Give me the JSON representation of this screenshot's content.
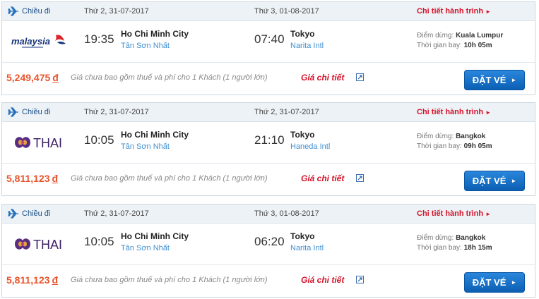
{
  "colors": {
    "header_bg": "#edf2f6",
    "link_red": "#d5132a",
    "price_orange": "#e8542c",
    "airport_blue": "#3f8fd1",
    "button_blue": "#0b5fb3"
  },
  "results": [
    {
      "direction_label": "Chiều đi",
      "dep_date": "Thứ 2, 31-07-2017",
      "arr_date": "Thứ 3, 01-08-2017",
      "details_label": "Chi tiết hành trình",
      "airline": "malaysia",
      "airline_logo_text": "malaysia",
      "dep_time": "19:35",
      "dep_city": "Ho Chi Minh City",
      "dep_airport": "Tân Sơn Nhất",
      "arr_time": "07:40",
      "arr_city": "Tokyo",
      "arr_airport": "Narita Intl",
      "stop_label": "Điểm dừng:",
      "stop_value": "Kuala Lumpur",
      "duration_label": "Thời gian bay:",
      "duration_value": "10h 05m",
      "price": "5,249,475",
      "currency": "đ",
      "price_note": "Giá chưa bao gồm thuế và phí cho 1 Khách (1 người lớn)",
      "fare_details_label": "Giá chi tiết",
      "book_label": "ĐẶT VÉ"
    },
    {
      "direction_label": "Chiều đi",
      "dep_date": "Thứ 2, 31-07-2017",
      "arr_date": "Thứ 2, 31-07-2017",
      "details_label": "Chi tiết hành trình",
      "airline": "thai",
      "airline_logo_text": "THAI",
      "dep_time": "10:05",
      "dep_city": "Ho Chi Minh City",
      "dep_airport": "Tân Sơn Nhất",
      "arr_time": "21:10",
      "arr_city": "Tokyo",
      "arr_airport": "Haneda Intl",
      "stop_label": "Điểm dừng:",
      "stop_value": "Bangkok",
      "duration_label": "Thời gian bay:",
      "duration_value": "09h 05m",
      "price": "5,811,123",
      "currency": "đ",
      "price_note": "Giá chưa bao gồm thuế và phí cho 1 Khách (1 người lớn)",
      "fare_details_label": "Giá chi tiết",
      "book_label": "ĐẶT VÉ"
    },
    {
      "direction_label": "Chiều đi",
      "dep_date": "Thứ 2, 31-07-2017",
      "arr_date": "Thứ 3, 01-08-2017",
      "details_label": "Chi tiết hành trình",
      "airline": "thai",
      "airline_logo_text": "THAI",
      "dep_time": "10:05",
      "dep_city": "Ho Chi Minh City",
      "dep_airport": "Tân Sơn Nhất",
      "arr_time": "06:20",
      "arr_city": "Tokyo",
      "arr_airport": "Narita Intl",
      "stop_label": "Điểm dừng:",
      "stop_value": "Bangkok",
      "duration_label": "Thời gian bay:",
      "duration_value": "18h 15m",
      "price": "5,811,123",
      "currency": "đ",
      "price_note": "Giá chưa bao gồm thuế và phí cho 1 Khách (1 người lớn)",
      "fare_details_label": "Giá chi tiết",
      "book_label": "ĐẶT VÉ"
    }
  ]
}
